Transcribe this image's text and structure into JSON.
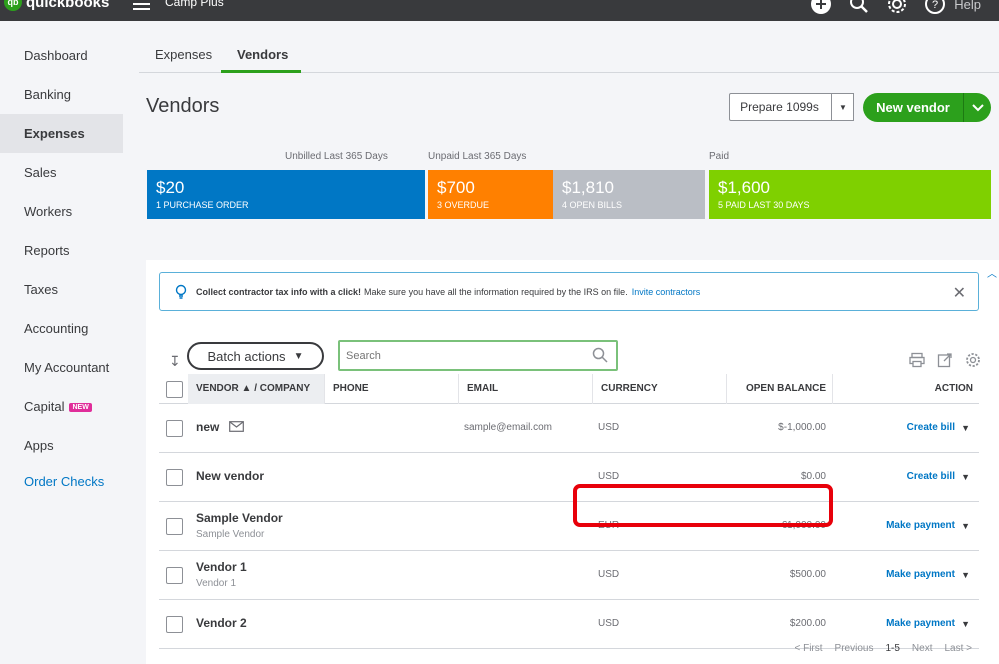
{
  "app": {
    "logo_text": "quickbooks",
    "logo_mark": "qb",
    "company_name": "Camp Plus",
    "help_label": "Help"
  },
  "sidebar": {
    "items": [
      {
        "label": "Dashboard"
      },
      {
        "label": "Banking"
      },
      {
        "label": "Expenses"
      },
      {
        "label": "Sales"
      },
      {
        "label": "Workers"
      },
      {
        "label": "Reports"
      },
      {
        "label": "Taxes"
      },
      {
        "label": "Accounting"
      },
      {
        "label": "My Accountant"
      },
      {
        "label": "Capital",
        "badge": "NEW"
      },
      {
        "label": "Apps"
      },
      {
        "label": "Order Checks"
      }
    ],
    "active": "Expenses"
  },
  "tabs": [
    {
      "label": "Expenses"
    },
    {
      "label": "Vendors"
    }
  ],
  "page": {
    "title": "Vendors"
  },
  "buttons": {
    "prepare_1099": "Prepare 1099s",
    "new_vendor": "New vendor",
    "batch_actions": "Batch actions"
  },
  "money_bar": {
    "labels": {
      "unbilled": "Unbilled Last 365 Days",
      "unpaid": "Unpaid Last 365 Days",
      "paid": "Paid"
    },
    "segments": [
      {
        "amount": "$20",
        "sub": "1 PURCHASE ORDER",
        "color": "#0077c5"
      },
      {
        "amount": "$700",
        "sub": "3 OVERDUE",
        "color": "#ff8000"
      },
      {
        "amount": "$1,810",
        "sub": "4 OPEN BILLS",
        "color": "#babec5"
      },
      {
        "amount": "$1,600",
        "sub": "5 PAID LAST 30 DAYS",
        "color": "#7fd000"
      }
    ]
  },
  "banner": {
    "bold": "Collect contractor tax info with a click!",
    "message": "Make sure you have all the information required by the IRS on file.",
    "link": "Invite contractors"
  },
  "search": {
    "placeholder": "Search"
  },
  "table": {
    "headers": {
      "vendor": "VENDOR ▲ / COMPANY",
      "phone": "PHONE",
      "email": "EMAIL",
      "currency": "CURRENCY",
      "balance": "OPEN BALANCE",
      "action": "ACTION"
    },
    "rows": [
      {
        "name": "new",
        "company": "",
        "email": "sample@email.com",
        "currency": "USD",
        "balance": "$-1,000.00",
        "action": "Create bill"
      },
      {
        "name": "New vendor",
        "company": "",
        "email": "",
        "currency": "USD",
        "balance": "$0.00",
        "action": "Create bill"
      },
      {
        "name": "Sample Vendor",
        "company": "Sample Vendor",
        "email": "",
        "currency": "EUR",
        "balance": "€1,000.00",
        "action": "Make payment"
      },
      {
        "name": "Vendor 1",
        "company": "Vendor 1",
        "email": "",
        "currency": "USD",
        "balance": "$500.00",
        "action": "Make payment"
      },
      {
        "name": "Vendor 2",
        "company": "",
        "email": "",
        "currency": "USD",
        "balance": "$200.00",
        "action": "Make payment"
      }
    ]
  },
  "pager": {
    "first": "< First",
    "previous": "Previous",
    "range": "1-5",
    "next": "Next",
    "last": "Last >"
  },
  "colors": {
    "accent_green": "#2ca01c",
    "link_blue": "#0077c5",
    "highlight_red": "#e8000a",
    "badge_pink": "#e02d9a"
  }
}
